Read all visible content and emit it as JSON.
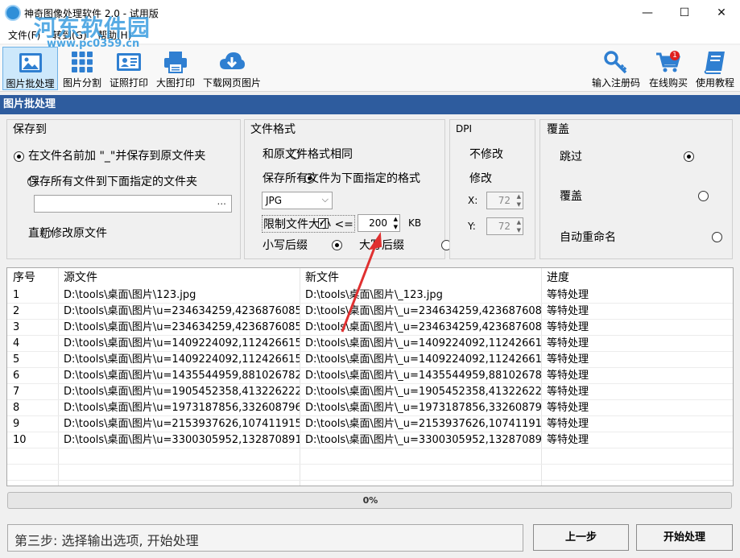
{
  "window": {
    "title": "神奇图像处理软件 2.0 - 试用版",
    "minimize": "—",
    "maximize": "☐",
    "close": "✕"
  },
  "watermark": {
    "logo": "河东软件园",
    "url": "www.pc0359.cn"
  },
  "menu": [
    {
      "label": "文件(F)"
    },
    {
      "label": "转到(G)"
    },
    {
      "label": "帮助(H)"
    }
  ],
  "toolbar": {
    "left": [
      {
        "label": "图片批处理",
        "icon": "image-icon"
      },
      {
        "label": "图片分割",
        "icon": "grid-icon"
      },
      {
        "label": "证照打印",
        "icon": "id-card-icon"
      },
      {
        "label": "大图打印",
        "icon": "printer-icon"
      },
      {
        "label": "下载网页图片",
        "icon": "cloud-download-icon"
      }
    ],
    "right": [
      {
        "label": "输入注册码",
        "icon": "key-icon"
      },
      {
        "label": "在线购买",
        "icon": "cart-icon",
        "badge": "1"
      },
      {
        "label": "使用教程",
        "icon": "book-icon"
      }
    ]
  },
  "section_header": "图片批处理",
  "save_to": {
    "title": "保存到",
    "opt1": "在文件名前加 \"_\"并保存到原文件夹",
    "opt2": "保存所有文件到下面指定的文件夹",
    "folder_value": "",
    "browse": "...",
    "opt3": "直新修改原文件",
    "selected": 1
  },
  "file_format": {
    "title": "文件格式",
    "opt1": "和原文件格式相同",
    "opt2": "保存所有文件为下面指定的格式",
    "format_value": "JPG",
    "limit_label": "限制文件大小 <=",
    "limit_value": "200",
    "limit_unit": "KB",
    "lower_suffix": "小写后缀",
    "upper_suffix": "大写后缀"
  },
  "dpi": {
    "title": "DPI",
    "opt1": "不修改",
    "opt2": "修改",
    "x_label": "X:",
    "x_value": "72",
    "y_label": "Y:",
    "y_value": "72"
  },
  "overwrite": {
    "title": "覆盖",
    "opt1": "跳过",
    "opt2": "覆盖",
    "opt3": "自动重命名"
  },
  "table": {
    "headers": [
      "序号",
      "源文件",
      "新文件",
      "进度"
    ],
    "rows": [
      [
        "1",
        "D:\\tools\\桌面\\图片\\123.jpg",
        "D:\\tools\\桌面\\图片\\_123.jpg",
        "等特处理"
      ],
      [
        "2",
        "D:\\tools\\桌面\\图片\\u=234634259,4236876085...",
        "D:\\tools\\桌面\\图片\\_u=234634259,423687608...",
        "等特处理"
      ],
      [
        "3",
        "D:\\tools\\桌面\\图片\\u=234634259,4236876085...",
        "D:\\tools\\桌面\\图片\\_u=234634259,423687608...",
        "等特处理"
      ],
      [
        "4",
        "D:\\tools\\桌面\\图片\\u=1409224092,112426615...",
        "D:\\tools\\桌面\\图片\\_u=1409224092,11242661...",
        "等特处理"
      ],
      [
        "5",
        "D:\\tools\\桌面\\图片\\u=1409224092,112426615...",
        "D:\\tools\\桌面\\图片\\_u=1409224092,11242661...",
        "等特处理"
      ],
      [
        "6",
        "D:\\tools\\桌面\\图片\\u=1435544959,881026782...",
        "D:\\tools\\桌面\\图片\\_u=1435544959,88102678...",
        "等特处理"
      ],
      [
        "7",
        "D:\\tools\\桌面\\图片\\u=1905452358,413226222...",
        "D:\\tools\\桌面\\图片\\_u=1905452358,41322622...",
        "等特处理"
      ],
      [
        "8",
        "D:\\tools\\桌面\\图片\\u=1973187856,332608796...",
        "D:\\tools\\桌面\\图片\\_u=1973187856,33260879...",
        "等特处理"
      ],
      [
        "9",
        "D:\\tools\\桌面\\图片\\u=2153937626,107411915...",
        "D:\\tools\\桌面\\图片\\_u=2153937626,10741191...",
        "等特处理"
      ],
      [
        "10",
        "D:\\tools\\桌面\\图片\\u=3300305952,132870891...",
        "D:\\tools\\桌面\\图片\\_u=3300305952,13287089...",
        "等特处理"
      ]
    ]
  },
  "progress": {
    "text": "0%",
    "value": 0
  },
  "status_text": "第三步: 选择输出选项, 开始处理",
  "buttons": {
    "prev": "上一步",
    "start": "开始处理"
  },
  "colors": {
    "accent": "#2e5c9e",
    "annotation_arrow": "#e03030"
  }
}
